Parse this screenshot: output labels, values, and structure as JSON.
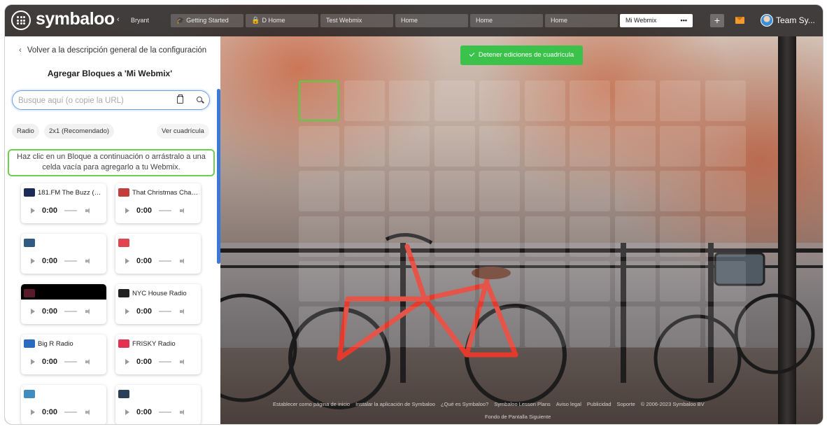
{
  "app": {
    "logo_text": "symbaloo"
  },
  "topbar": {
    "back_user": "Bryant",
    "tabs": [
      {
        "label": "Getting Started",
        "icon": "graduation-cap-icon"
      },
      {
        "label": "D Home",
        "icon": "lock-icon"
      },
      {
        "label": "Test Webmix"
      },
      {
        "label": "Home"
      },
      {
        "label": "Home"
      },
      {
        "label": "Home"
      }
    ],
    "active_tab": {
      "label": "Mi Webmix",
      "menu": "•••"
    },
    "add_label": "+",
    "user_name": "Team Sy..."
  },
  "panel": {
    "back_link": "Volver a la descripción general de la configuración",
    "title": "Agregar Bloques a 'Mi Webmix'",
    "search_placeholder": "Busque aquí (o copie la URL)",
    "chips": {
      "category": "Radio",
      "size": "2x1 (Recomendado)",
      "view_grid": "Ver cuadrícula"
    },
    "info_text": "Haz clic en un Bloque a continuación o arrástralo a una celda vacía para agregarlo a tu Webmix.",
    "stations": [
      {
        "name": "181.FM The Buzz (Alt. ...",
        "time": "0:00",
        "logo_color": "#1b2a57"
      },
      {
        "name": "That Christmas Chan...",
        "time": "0:00",
        "logo_color": "#c33d3d"
      },
      {
        "name": "",
        "time": "0:00",
        "logo_color": "#2f5b82"
      },
      {
        "name": "",
        "time": "0:00",
        "logo_color": "#e0454f"
      },
      {
        "name": "",
        "time": "0:00",
        "logo_color": "#5a1a2a"
      },
      {
        "name": "NYC House Radio",
        "time": "0:00",
        "logo_color": "#222222"
      },
      {
        "name": "Big R Radio",
        "time": "0:00",
        "logo_color": "#2a6bbf"
      },
      {
        "name": "FRISKY Radio",
        "time": "0:00",
        "logo_color": "#e4314f"
      },
      {
        "name": "",
        "time": "0:00",
        "logo_color": "#3f8cc0"
      },
      {
        "name": "",
        "time": "0:00",
        "logo_color": "#2b3f5a"
      }
    ]
  },
  "grid": {
    "stop_label": "Detener ediciones de cuadrícula"
  },
  "footer": {
    "links": [
      "Establecer como página de inicio",
      "Instalar la aplicación de Symbaloo",
      "¿Qué es Symbaloo?",
      "Symbaloo Lesson Plans",
      "Aviso legal",
      "Publicidad",
      "Soporte",
      "© 2006-2023 Symbaloo BV"
    ],
    "next_background": "Fondo de Pantalla Siguiente"
  }
}
